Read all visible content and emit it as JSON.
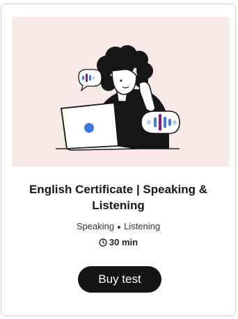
{
  "card": {
    "image_alt": "Person listening to audio on a laptop",
    "title": "English Certificate | Speaking & Listening",
    "skills": [
      "Speaking",
      "Listening"
    ],
    "duration": "30 min",
    "buy_label": "Buy test"
  },
  "colors": {
    "hero_background": "#f6e9e8",
    "button": "#141414",
    "accent_blue": "#3f78e0",
    "accent_purple": "#7a1f7e"
  },
  "icons": [
    "clock-icon",
    "sound-wave-icon",
    "laptop-icon"
  ]
}
